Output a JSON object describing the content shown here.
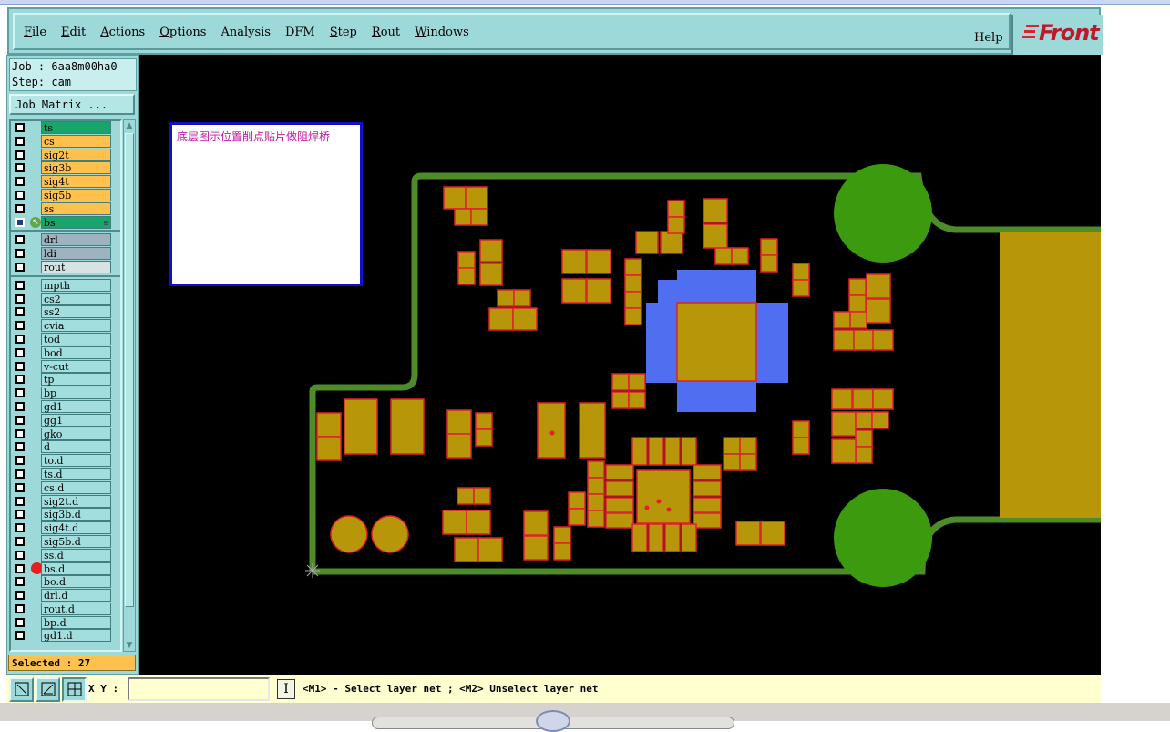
{
  "menubar": {
    "items": [
      {
        "label": "File",
        "underline": "F",
        "rest": "ile"
      },
      {
        "label": "Edit",
        "underline": "E",
        "rest": "dit"
      },
      {
        "label": "Actions",
        "underline": "A",
        "rest": "ctions"
      },
      {
        "label": "Options",
        "underline": "O",
        "rest": "ptions"
      },
      {
        "label": "Analysis",
        "underline": "",
        "rest": "Analysis"
      },
      {
        "label": "DFM",
        "underline": "",
        "rest": "DFM"
      },
      {
        "label": "Step",
        "underline": "S",
        "rest": "tep"
      },
      {
        "label": "Rout",
        "underline": "R",
        "rest": "out"
      },
      {
        "label": "Windows",
        "underline": "W",
        "rest": "indows"
      }
    ],
    "help": "Help",
    "logo": "Front"
  },
  "panel": {
    "job": "Job : 6aa8m00ha0",
    "step": "Step: cam",
    "job_matrix": "Job Matrix ...",
    "selected": "Selected : 27"
  },
  "layers": {
    "signal": [
      {
        "name": "ts",
        "color": "green"
      },
      {
        "name": "cs",
        "color": "orange"
      },
      {
        "name": "sig2t",
        "color": "orange"
      },
      {
        "name": "sig3b",
        "color": "orange"
      },
      {
        "name": "sig4t",
        "color": "orange"
      },
      {
        "name": "sig5b",
        "color": "orange"
      },
      {
        "name": "ss",
        "color": "orange"
      },
      {
        "name": "bs",
        "color": "green"
      }
    ],
    "drill": [
      {
        "name": "drl",
        "color": "gray"
      },
      {
        "name": "ldi",
        "color": "gray"
      },
      {
        "name": "rout",
        "color": "lgray"
      }
    ],
    "misc": [
      {
        "name": "mpth"
      },
      {
        "name": "cs2"
      },
      {
        "name": "ss2"
      },
      {
        "name": "cvia"
      },
      {
        "name": "tod"
      },
      {
        "name": "bod"
      },
      {
        "name": "v-cut"
      },
      {
        "name": "tp"
      },
      {
        "name": "bp"
      },
      {
        "name": "gd1"
      },
      {
        "name": "gg1"
      },
      {
        "name": "gko"
      },
      {
        "name": "d"
      },
      {
        "name": "to.d"
      },
      {
        "name": "ts.d"
      },
      {
        "name": "cs.d"
      },
      {
        "name": "sig2t.d"
      },
      {
        "name": "sig3b.d"
      },
      {
        "name": "sig4t.d"
      },
      {
        "name": "sig5b.d"
      },
      {
        "name": "ss.d"
      },
      {
        "name": "bs.d"
      },
      {
        "name": "bo.d"
      },
      {
        "name": "drl.d"
      },
      {
        "name": "rout.d"
      },
      {
        "name": "bp.d"
      },
      {
        "name": "gd1.d"
      }
    ]
  },
  "canvas": {
    "note": "底层图示位置削点贴片做阻焊桥",
    "board_outline_color": "#4e8c2a",
    "pad_color": "#b8960a",
    "pad_edge_color": "#e0202a",
    "pad_blue_color": "#4f6ef0",
    "mount_hole_color": "#3b9a0e"
  },
  "status": {
    "xy_label": "X Y :",
    "xy_value": "",
    "info_icon": "I",
    "message": "<M1> - Select layer net ; <M2> Unselect layer net"
  },
  "colors": {
    "panel_bg": "#9ed9d9",
    "layer_green": "#17a56c",
    "layer_orange": "#ffc14d",
    "canvas_bg": "#000000",
    "status_bg": "#ffffd0"
  }
}
